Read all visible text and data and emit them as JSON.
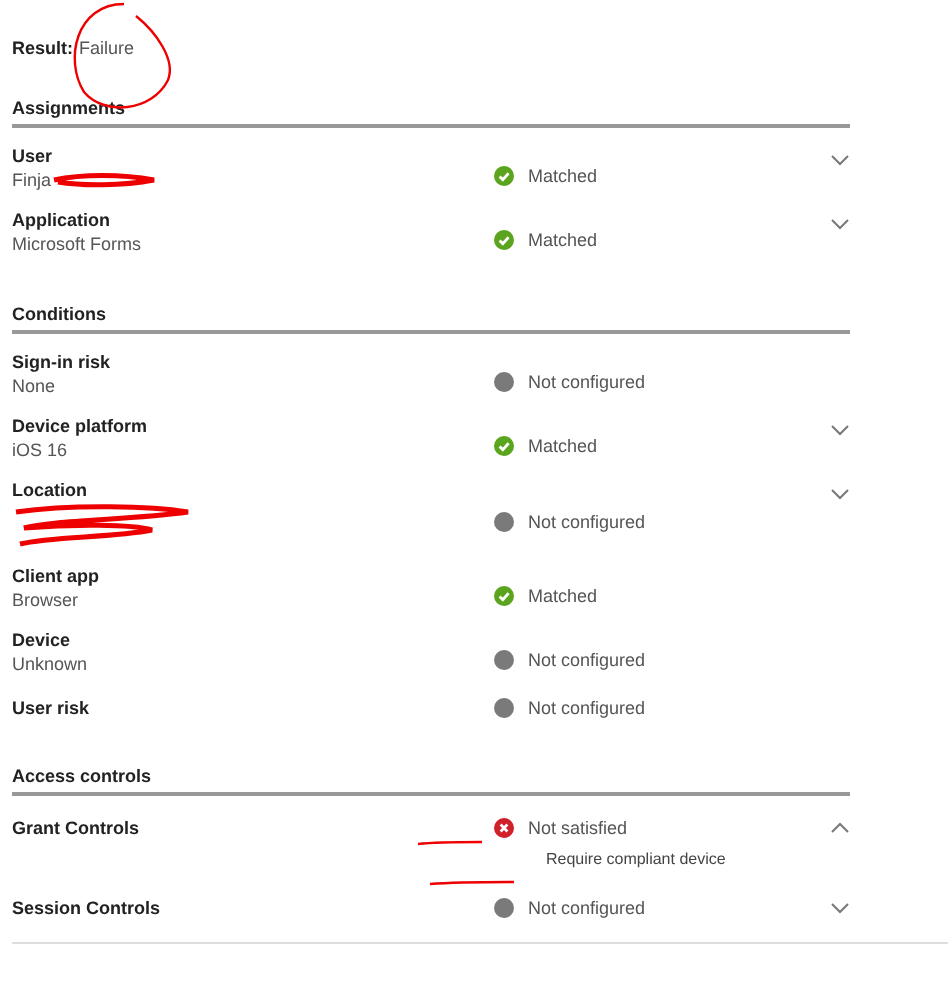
{
  "result": {
    "label": "Result:",
    "value": "Failure"
  },
  "sections": [
    {
      "title": "Assignments",
      "rows": [
        {
          "label": "User",
          "value": "Finja",
          "redacted": true,
          "kind": "matched",
          "status_text": "Matched",
          "expanded": false
        },
        {
          "label": "Application",
          "value": "Microsoft Forms",
          "kind": "matched",
          "status_text": "Matched",
          "expanded": false
        }
      ]
    },
    {
      "title": "Conditions",
      "rows": [
        {
          "label": "Sign-in risk",
          "value": "None",
          "kind": "not_configured",
          "status_text": "Not configured"
        },
        {
          "label": "Device platform",
          "value": "iOS 16",
          "kind": "matched",
          "status_text": "Matched",
          "expanded": false
        },
        {
          "label": "Location",
          "redacted": true,
          "kind": "not_configured",
          "status_text": "Not configured",
          "expanded": false
        },
        {
          "label": "Client app",
          "value": "Browser",
          "kind": "matched",
          "status_text": "Matched"
        },
        {
          "label": "Device",
          "value": "Unknown",
          "kind": "not_configured",
          "status_text": "Not configured"
        },
        {
          "label": "User risk",
          "kind": "not_configured",
          "status_text": "Not configured"
        }
      ]
    },
    {
      "title": "Access controls",
      "rows": [
        {
          "label": "Grant Controls",
          "kind": "not_satisfied",
          "status_text": "Not satisfied",
          "expanded": true,
          "details": [
            "Require compliant device"
          ]
        },
        {
          "label": "Session Controls",
          "kind": "not_configured",
          "status_text": "Not configured",
          "expanded": false
        }
      ]
    }
  ]
}
